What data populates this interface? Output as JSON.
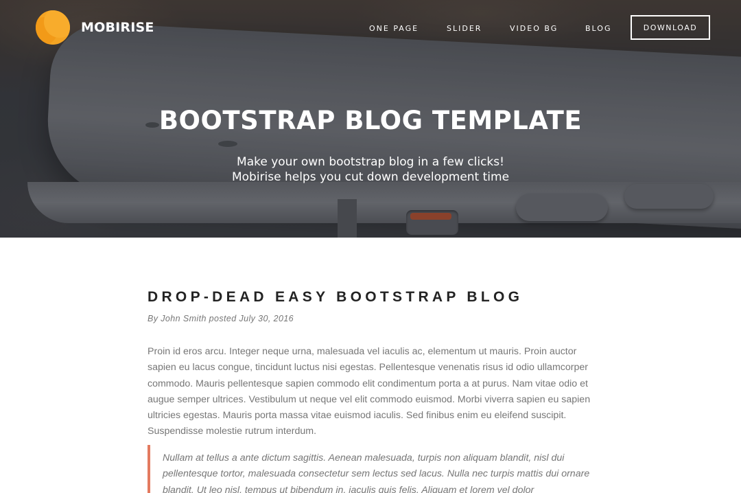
{
  "brand": {
    "name": "MOBIRISE"
  },
  "nav": {
    "items": [
      {
        "label": "ONE PAGE"
      },
      {
        "label": "SLIDER"
      },
      {
        "label": "VIDEO BG"
      },
      {
        "label": "BLOG"
      }
    ],
    "download_label": "DOWNLOAD"
  },
  "hero": {
    "title": "BOOTSTRAP BLOG TEMPLATE",
    "subtitle_line1": "Make your own bootstrap blog in a few clicks!",
    "subtitle_line2": "Mobirise helps you cut down development time"
  },
  "post": {
    "title": "DROP-DEAD EASY BOOTSTRAP BLOG",
    "meta": "By John Smith posted July 30, 2016",
    "body": "Proin id eros arcu. Integer neque urna, malesuada vel iaculis ac, elementum ut mauris. Proin auctor sapien eu lacus congue, tincidunt luctus nisi egestas. Pellentesque venenatis risus id odio ullamcorper commodo. Mauris pellentesque sapien commodo elit condimentum porta a at purus. Nam vitae odio et augue semper ultrices. Vestibulum ut neque vel elit commodo euismod. Morbi viverra sapien eu sapien ultricies egestas. Mauris porta massa vitae euismod iaculis. Sed finibus enim eu eleifend suscipit. Suspendisse molestie rutrum interdum.",
    "quote": "Nullam at tellus a ante dictum sagittis. Aenean malesuada, turpis non aliquam blandit, nisl dui pellentesque tortor, malesuada consectetur sem lectus sed lacus. Nulla nec turpis mattis dui ornare blandit. Ut leo nisl, tempus ut bibendum in, iaculis quis felis. Aliquam et lorem vel dolor"
  },
  "colors": {
    "logo_orange": "#f4a423",
    "quote_border": "#e37a5f",
    "body_text": "#767676",
    "title_text": "#232323"
  }
}
